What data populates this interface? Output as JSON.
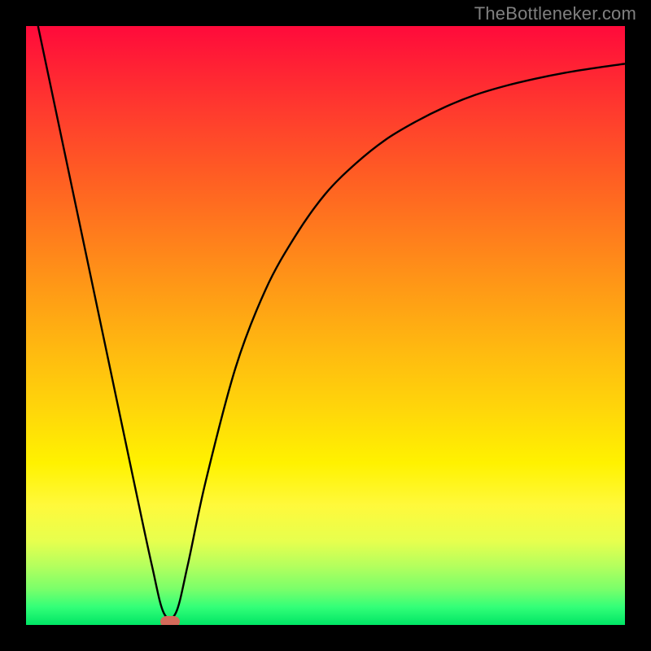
{
  "watermark": "TheBottleneker.com",
  "colors": {
    "frame": "#000000",
    "curve": "#000000",
    "marker": "#d46a5a",
    "watermark": "#808080"
  },
  "chart_data": {
    "type": "line",
    "title": "",
    "xlabel": "",
    "ylabel": "",
    "xlim": [
      0,
      100
    ],
    "ylim": [
      0,
      100
    ],
    "series": [
      {
        "name": "bottleneck-curve",
        "x": [
          2,
          6,
          10,
          14,
          18,
          21,
          23,
          25,
          27,
          30,
          35,
          40,
          45,
          50,
          55,
          60,
          65,
          70,
          75,
          80,
          85,
          90,
          95,
          100
        ],
        "values": [
          100,
          81,
          62,
          43,
          24,
          10,
          2,
          2,
          10,
          24,
          43,
          56,
          65,
          72,
          77,
          81,
          84,
          86.5,
          88.5,
          90,
          91.2,
          92.2,
          93,
          93.7
        ]
      }
    ],
    "annotations": [
      {
        "name": "minimum-marker",
        "x": 24,
        "y": 0.6
      }
    ]
  }
}
